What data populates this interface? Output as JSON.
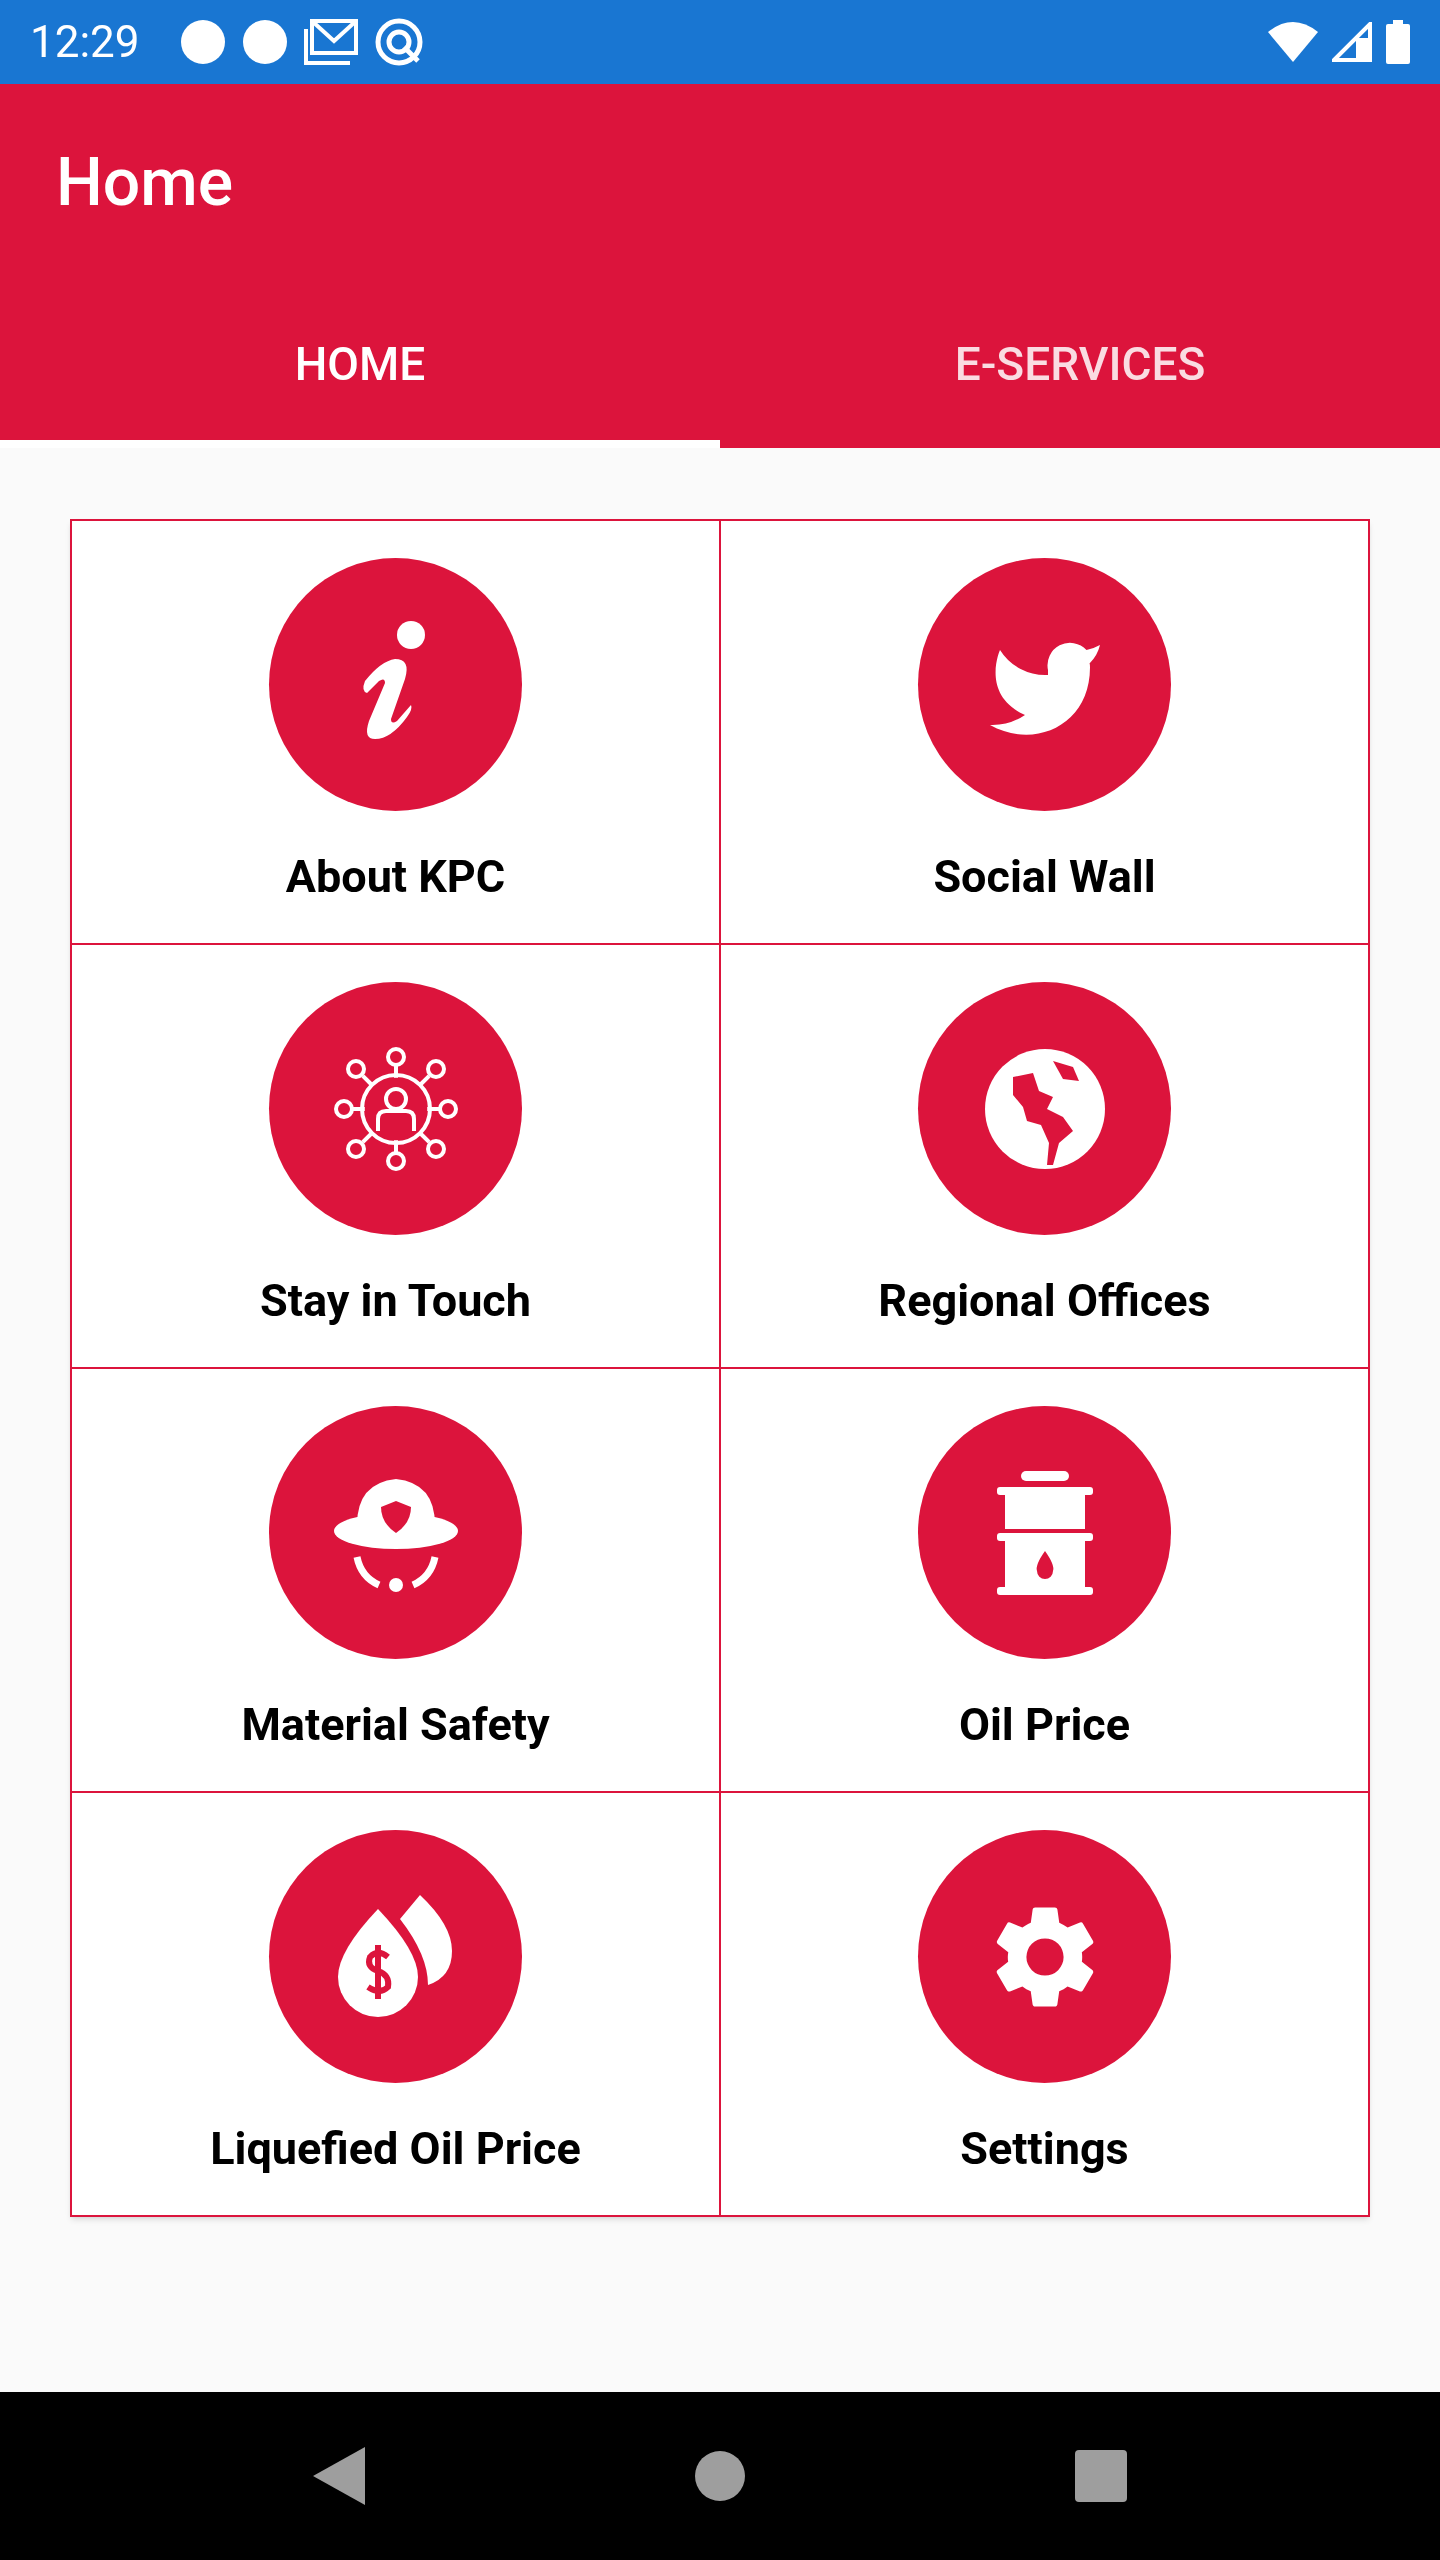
{
  "status_bar": {
    "time": "12:29"
  },
  "app_bar": {
    "title": "Home"
  },
  "tabs": [
    {
      "label": "HOME",
      "selected": true
    },
    {
      "label": "E-SERVICES",
      "selected": false
    }
  ],
  "tiles": [
    {
      "label": "About KPC",
      "kind": "info"
    },
    {
      "label": "Social Wall",
      "kind": "bird"
    },
    {
      "label": "Stay in Touch",
      "kind": "network"
    },
    {
      "label": "Regional Offices",
      "kind": "globe"
    },
    {
      "label": "Material Safety",
      "kind": "helmet"
    },
    {
      "label": "Oil Price",
      "kind": "barrel"
    },
    {
      "label": "Liquefied Oil Price",
      "kind": "drops"
    },
    {
      "label": "Settings",
      "kind": "gear"
    }
  ]
}
